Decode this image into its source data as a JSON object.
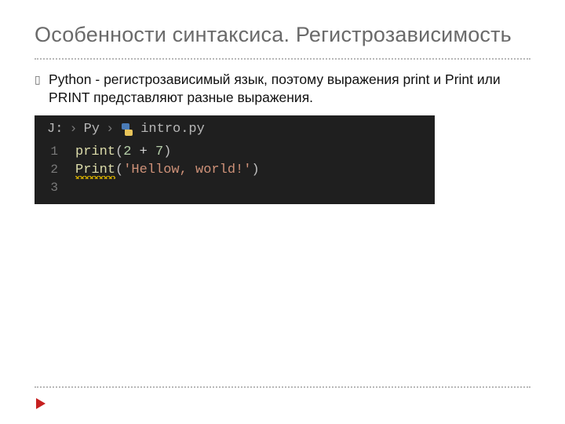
{
  "title": "Особенности синтаксиса. Регистрозависимость",
  "body": "Python - регистрозависимый язык, поэтому выражения print и Print или PRINT представляют разные выражения.",
  "bullet_marker": "▯",
  "breadcrumb": {
    "drive": "J:",
    "folder": "Py",
    "file": "intro.py",
    "sep": "›"
  },
  "code": {
    "line1": {
      "num": "1",
      "call": "print",
      "inner_a": "2",
      "op": "+",
      "inner_b": "7",
      "lp": "(",
      "rp": ")"
    },
    "line2": {
      "num": "2",
      "call": "Print",
      "lp": "(",
      "str": "'Hellow, world!'",
      "rp": ")"
    },
    "line3": {
      "num": "3"
    }
  }
}
